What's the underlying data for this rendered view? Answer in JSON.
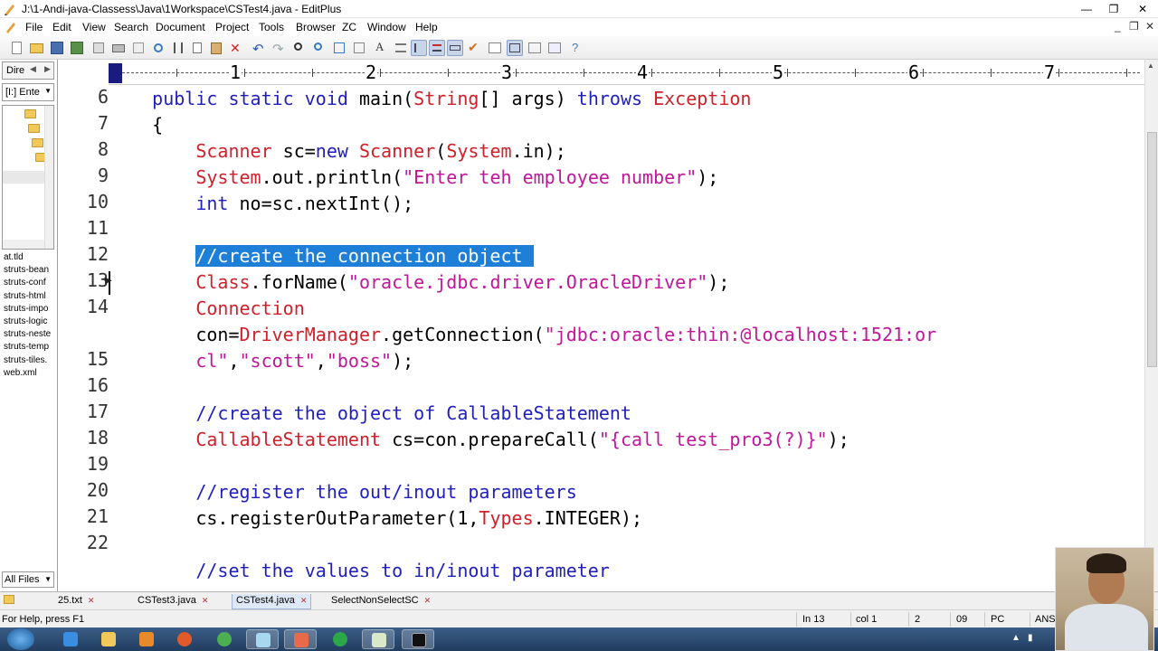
{
  "window": {
    "title": "J:\\1-Andi-java-Classess\\Java\\1Workspace\\CSTest4.java - EditPlus",
    "minimize": "—",
    "maximize": "❐",
    "close": "✕"
  },
  "menu": {
    "items": [
      "File",
      "Edit",
      "View",
      "Search",
      "Document",
      "Project",
      "Tools",
      "Browser",
      "ZC",
      "Window",
      "Help"
    ],
    "controls": [
      "_",
      "❐",
      "✕"
    ]
  },
  "sidebar": {
    "tab_label": "Dire",
    "drive": "[I:] Ente",
    "files": [
      "at.tld",
      "struts-bean",
      "struts-conf",
      "struts-html",
      "struts-impo",
      "struts-logic",
      "struts-neste",
      "struts-temp",
      "struts-tiles.",
      "web.xml"
    ],
    "filter": "All Files"
  },
  "ruler": {
    "numbers": [
      "1",
      "2",
      "3",
      "4",
      "5",
      "6",
      "7"
    ]
  },
  "editor": {
    "line_numbers": [
      "6",
      "7",
      "8",
      "9",
      "10",
      "11",
      "12",
      "13",
      "14",
      "",
      "15",
      "16",
      "17",
      "18",
      "19",
      "20",
      "21",
      "22"
    ],
    "lines": [
      [
        {
          "t": "    "
        },
        {
          "t": "public static void ",
          "c": "kw"
        },
        {
          "t": "main("
        },
        {
          "t": "String",
          "c": "cls"
        },
        {
          "t": "[] args) "
        },
        {
          "t": "throws ",
          "c": "kw"
        },
        {
          "t": "Exception",
          "c": "cls"
        }
      ],
      [
        {
          "t": "    {"
        }
      ],
      [
        {
          "t": "        "
        },
        {
          "t": "Scanner",
          "c": "cls"
        },
        {
          "t": " sc="
        },
        {
          "t": "new ",
          "c": "kw"
        },
        {
          "t": "Scanner",
          "c": "cls"
        },
        {
          "t": "("
        },
        {
          "t": "System",
          "c": "cls"
        },
        {
          "t": ".in);"
        }
      ],
      [
        {
          "t": "        "
        },
        {
          "t": "System",
          "c": "cls"
        },
        {
          "t": ".out.println("
        },
        {
          "t": "\"Enter teh employee number\"",
          "c": "str"
        },
        {
          "t": ");"
        }
      ],
      [
        {
          "t": "        "
        },
        {
          "t": "int",
          "c": "kw"
        },
        {
          "t": " no=sc.nextInt();"
        }
      ],
      [
        {
          "t": ""
        }
      ],
      [
        {
          "t": "        "
        },
        {
          "t": "//create the connection object ",
          "c": "sel"
        }
      ],
      [
        {
          "t": "        "
        },
        {
          "t": "Class",
          "c": "cls"
        },
        {
          "t": ".forName("
        },
        {
          "t": "\"oracle.jdbc.driver.OracleDriver\"",
          "c": "str"
        },
        {
          "t": ");"
        }
      ],
      [
        {
          "t": "        "
        },
        {
          "t": "Connection",
          "c": "cls"
        }
      ],
      [
        {
          "t": "        con="
        },
        {
          "t": "DriverManager",
          "c": "cls"
        },
        {
          "t": ".getConnection("
        },
        {
          "t": "\"jdbc:oracle:thin:@localhost:1521:or",
          "c": "str"
        }
      ],
      [
        {
          "t": "        "
        },
        {
          "t": "cl\"",
          "c": "str"
        },
        {
          "t": ","
        },
        {
          "t": "\"scott\"",
          "c": "str"
        },
        {
          "t": ","
        },
        {
          "t": "\"boss\"",
          "c": "str"
        },
        {
          "t": ");"
        }
      ],
      [
        {
          "t": ""
        }
      ],
      [
        {
          "t": "        "
        },
        {
          "t": "//create the object of CallableStatement",
          "c": "com"
        }
      ],
      [
        {
          "t": "        "
        },
        {
          "t": "CallableStatement",
          "c": "cls"
        },
        {
          "t": " cs=con.prepareCall("
        },
        {
          "t": "\"{call test_pro3(?)}\"",
          "c": "str"
        },
        {
          "t": ");"
        }
      ],
      [
        {
          "t": ""
        }
      ],
      [
        {
          "t": "        "
        },
        {
          "t": "//register the out/inout parameters",
          "c": "com"
        }
      ],
      [
        {
          "t": "        cs.registerOutParameter(1,"
        },
        {
          "t": "Types",
          "c": "cls"
        },
        {
          "t": ".INTEGER);"
        }
      ],
      [
        {
          "t": ""
        }
      ],
      [
        {
          "t": "        "
        },
        {
          "t": "//set the values to in/inout parameter",
          "c": "com"
        }
      ]
    ]
  },
  "tabs": [
    {
      "label": "25.txt",
      "close": "✕"
    },
    {
      "label": "CSTest3.java",
      "close": "✕"
    },
    {
      "label": "CSTest4.java",
      "close": "✕"
    },
    {
      "label": "SelectNonSelectSC",
      "close": "✕"
    }
  ],
  "status": {
    "help": "For Help, press F1",
    "line": "In 13",
    "col": "col 1",
    "sel": "2",
    "chars": "09",
    "mode": "PC",
    "encoding": "ANSI"
  },
  "colors": {
    "keyword": "#1f1fbf",
    "class": "#d0202a",
    "string": "#c0169a",
    "selection": "#1e7fd8"
  }
}
